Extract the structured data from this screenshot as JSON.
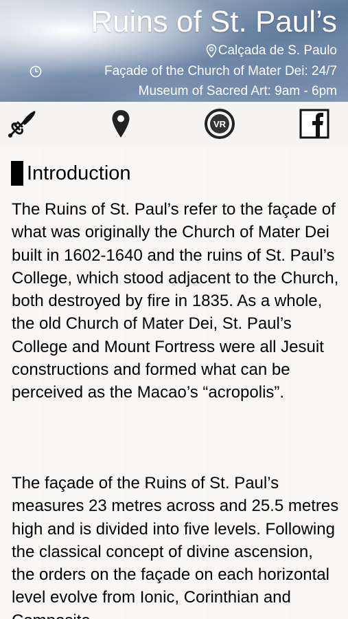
{
  "header": {
    "title": "Ruins of St. Paul’s",
    "location": "Calçada de S. Paulo",
    "hours": [
      "Façade of the Church of Mater Dei: 24/7",
      "Museum of Sacred Art: 9am - 6pm"
    ],
    "location_icon": "map-marker-outline-icon",
    "hours_icon": "clock-icon"
  },
  "toolbar": {
    "buttons": [
      {
        "name": "trumpet-icon"
      },
      {
        "name": "map-pin-icon"
      },
      {
        "name": "vr-icon"
      },
      {
        "name": "facebook-icon"
      }
    ]
  },
  "content": {
    "section_title": "Introduction",
    "paragraphs": [
      "The Ruins of St. Paul’s refer to the façade of what was originally the Church of Mater Dei built in 1602-1640 and the ruins of St. Paul’s College, which stood adjacent to the Church, both destroyed by fire in 1835. As a whole, the old Church of Mater Dei, St. Paul’s College and Mount Fortress were all Jesuit constructions and formed what can be perceived as the Macao’s “acropolis”.",
      "The façade of the Ruins of St. Paul’s measures 23 metres across and 25.5 metres high and is divided into five levels. Following the classical concept of divine ascension, the orders on the façade on each horizontal level evolve from Ionic, Corinthian and Composite"
    ]
  }
}
